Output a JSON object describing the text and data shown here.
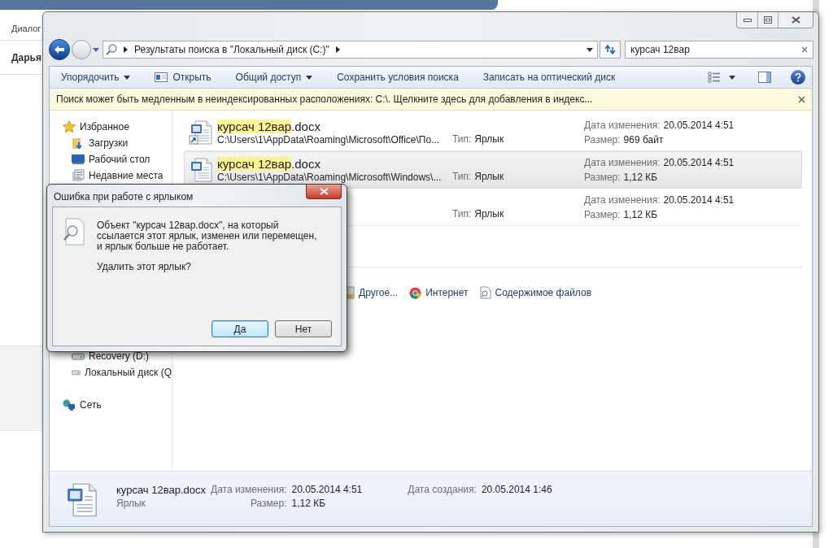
{
  "background_page": {
    "tab": "Диалог",
    "name": "Дарья"
  },
  "explorer": {
    "address": {
      "breadcrumb": "Результаты поиска в \"Локальный диск (C:)\""
    },
    "search": {
      "value": "курсач 12вар"
    },
    "toolbar": [
      {
        "label": "Упорядочить",
        "kind": "menu"
      },
      {
        "label": "Открыть",
        "kind": "open"
      },
      {
        "label": "Общий доступ",
        "kind": "menu"
      },
      {
        "label": "Сохранить условия поиска",
        "kind": "plain"
      },
      {
        "label": "Записать на оптический диск",
        "kind": "plain"
      }
    ],
    "info_bar": "Поиск может быть медленным в неиндексированных расположениях: C:\\. Щелкните здесь для добавления в индекс...",
    "sidebar": {
      "favorites": {
        "label": "Избранное",
        "children": [
          {
            "label": "Загрузки",
            "kind": "downloads"
          },
          {
            "label": "Рабочий стол",
            "kind": "desktop"
          },
          {
            "label": "Недавние места",
            "kind": "recent"
          }
        ]
      },
      "drives": [
        {
          "label": "Recovery (D:)",
          "kind": "drive"
        },
        {
          "label": "Локальный диск (Q",
          "kind": "drive"
        }
      ],
      "network": {
        "label": "Сеть"
      }
    },
    "results": [
      {
        "name_match": "курсач 12вар",
        "name_rest": ".docx",
        "path": "C:\\Users\\1\\AppData\\Roaming\\Microsoft\\Office\\По...",
        "type_label": "Тип:",
        "type": "Ярлык",
        "date_label": "Дата изменения:",
        "date": "20.05.2014 4:51",
        "size_label": "Размер:",
        "size": "969 байт",
        "selected": false
      },
      {
        "name_match": "курсач 12вар",
        "name_rest": ".docx",
        "path": "C:\\Users\\1\\AppData\\Roaming\\Microsoft\\Windows\\...",
        "type_label": "Тип:",
        "type": "Ярлык",
        "date_label": "Дата изменения:",
        "date": "20.05.2014 4:51",
        "size_label": "Размер:",
        "size": "1,12 КБ",
        "selected": true
      },
      {
        "type_label": "Тип:",
        "type": "Ярлык",
        "date_label": "Дата изменения:",
        "date": "20.05.2014 4:51",
        "size_label": "Размер:",
        "size": "1,12 КБ",
        "selected": false
      }
    ],
    "search_again": [
      {
        "label": "Другое...",
        "kind": "other"
      },
      {
        "label": "Интернет",
        "kind": "internet"
      },
      {
        "label": "Содержимое файлов",
        "kind": "contents"
      }
    ],
    "details": {
      "name": "курсач 12вар.docx",
      "type": "Ярлык",
      "modified_label": "Дата изменения:",
      "modified": "20.05.2014 4:51",
      "size_label": "Размер:",
      "size": "1,12 КБ",
      "created_label": "Дата создания:",
      "created": "20.05.2014 1:46"
    }
  },
  "dialog": {
    "title": "Ошибка при работе с ярлыком",
    "message": "Объект \"курсач 12вар.docx\", на который ссылается этот ярлык, изменен или перемещен, и ярлык больше не работает.",
    "question": "Удалить этот ярлык?",
    "buttons": [
      {
        "label": "Да",
        "selected": true
      },
      {
        "label": "Нет",
        "selected": false
      }
    ]
  }
}
